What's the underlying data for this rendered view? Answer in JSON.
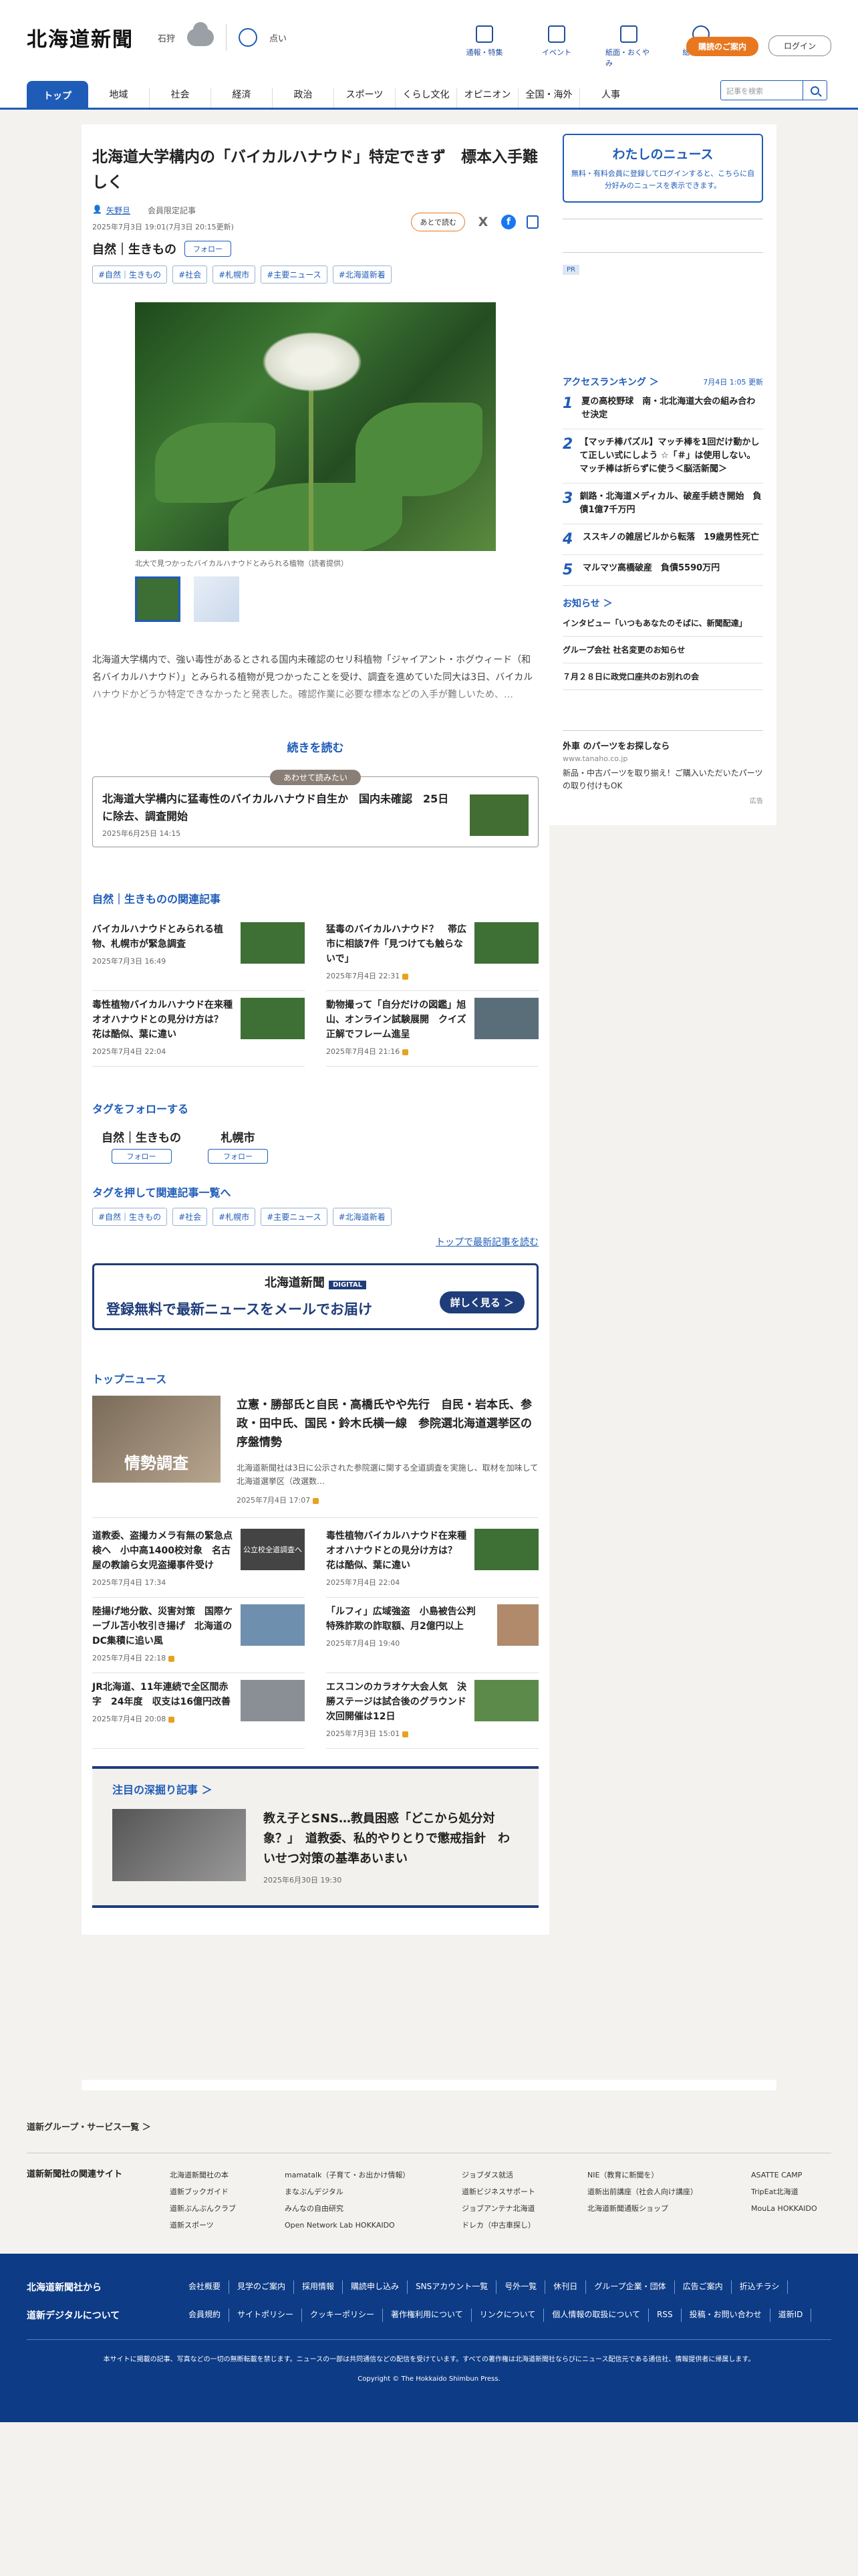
{
  "header": {
    "logo": "北海道新聞",
    "weather_location": "石狩",
    "uv_label": "点い",
    "icons": [
      {
        "label": "通報・特集",
        "icon": "flag-icon"
      },
      {
        "label": "イベント",
        "icon": "calendar-icon"
      },
      {
        "label": "紙面・おくやみ",
        "icon": "newspaper-icon"
      },
      {
        "label": "総合ガイド",
        "icon": "question-icon"
      }
    ],
    "contract_label": "購読のご案内",
    "login_label": "ログイン"
  },
  "nav": {
    "items": [
      "トップ",
      "地域",
      "社会",
      "経済",
      "政治",
      "スポーツ",
      "くらし文化",
      "オピニオン",
      "全国・海外",
      "人事"
    ],
    "search_placeholder": "記事を検索"
  },
  "article": {
    "title": "北海道大学構内の「バイカルハナウド」特定できず　標本入手難しく",
    "author": "矢野旦",
    "membership": "会員限定記事",
    "date": "2025年7月3日 19:01(7月3日 20:15更新)",
    "later_label": "あとで読む",
    "category": "自然｜生きもの",
    "follow_label": "フォロー",
    "tags": [
      "#自然｜生きもの",
      "#社会",
      "#札幌市",
      "#主要ニュース",
      "#北海道新着"
    ],
    "caption": "北大で見つかったバイカルハナウドとみられる植物（読者提供）",
    "lead": "北海道大学構内で、強い毒性があるとされる国内未確認のセリ科植物「ジャイアント・ホグウィード（和名バイカルハナウド）」とみられる植物が見つかったことを受け、調査を進めていた同大は3日、バイカルハナウドかどうか特定できなかったと発表した。確認作業に必要な標本などの入手が難しいため、…",
    "read_more": "続きを読む"
  },
  "also_read": {
    "badge": "あわせて読みたい",
    "title": "北海道大学構内に猛毒性のバイカルハナウド自生か　国内未確認　25日に除去、調査開始",
    "date": "2025年6月25日 14:15"
  },
  "related": {
    "heading": "自然｜生きものの関連記事",
    "items": [
      {
        "title": "バイカルハナウドとみられる植物、札幌市が緊急調査",
        "date": "2025年7月3日 16:49"
      },
      {
        "title": "猛毒のバイカルハナウド？　帯広市に相談7件「見つけても触らないで」",
        "date": "2025年7月4日 22:31"
      },
      {
        "title": "毒性植物バイカルハナウド在来種オオハナウドとの見分け方は？　花は酷似、葉に違い",
        "date": "2025年7月4日 22:04"
      },
      {
        "title": "動物撮って「自分だけの図鑑」旭山、オンライン試験展開　クイズ正解でフレーム進呈",
        "date": "2025年7月4日 21:16"
      }
    ]
  },
  "follow_tags": {
    "heading": "タグをフォローする",
    "items": [
      {
        "name": "自然｜生きもの",
        "label": "フォロー"
      },
      {
        "name": "札幌市",
        "label": "フォロー"
      }
    ]
  },
  "tag_search": {
    "heading": "タグを押して関連記事一覧へ",
    "tags": [
      "#自然｜生きもの",
      "#社会",
      "#札幌市",
      "#主要ニュース",
      "#北海道新着"
    ],
    "latest_link": "トップで最新記事を読む"
  },
  "banner": {
    "logo": "北海道新聞",
    "digital": "DIGITAL",
    "message": "登録無料で最新ニュースをメールでお届け",
    "cta": "詳しく見る ＞"
  },
  "top_news": {
    "heading": "トップニュース",
    "lead": {
      "title": "立憲・勝部氏と自民・高橋氏やや先行　自民・岩本氏、参政・田中氏、国民・鈴木氏横一線　参院選北海道選挙区の序盤情勢",
      "summary": "北海道新聞社は3日に公示された参院選に関する全道調査を実施し、取材を加味して北海道選挙区（改選数…",
      "date": "2025年7月4日 17:07",
      "image_text": "情勢調査"
    },
    "items": [
      {
        "title": "道教委、盗撮カメラ有無の緊急点検へ　小中高1400校対象　名古屋の教諭ら女児盗撮事件受け",
        "date": "2025年7月4日 17:34",
        "image_text": "公立校全道調査へ"
      },
      {
        "title": "毒性植物バイカルハナウド在来種オオハナウドとの見分け方は？　花は酷似、葉に違い",
        "date": "2025年7月4日 22:04"
      },
      {
        "title": "陸揚げ地分散、災害対策　国際ケーブル苫小牧引き揚げ　北海道のDC集積に追い風",
        "date": "2025年7月4日 22:18"
      },
      {
        "title": "「ルフィ」広域強盗　小島被告公判　特殊詐欺の詐取額、月2億円以上",
        "date": "2025年7月4日 19:40"
      },
      {
        "title": "JR北海道、11年連続で全区間赤字　24年度　収支は16億円改善",
        "date": "2025年7月4日 20:08"
      },
      {
        "title": "エスコンのカラオケ大会人気　決勝ステージは試合後のグラウンド　次回開催は12日",
        "date": "2025年7月3日 15:01"
      }
    ]
  },
  "deep": {
    "heading": "注目の深掘り記事 ＞",
    "title": "教え子とSNS…教員困惑「どこから処分対象？」　道教委、私的やりとりで懲戒指針　わいせつ対策の基準あいまい",
    "date": "2025年6月30日 19:30"
  },
  "sidebar": {
    "mynews_title": "わたしのニュース",
    "mynews_text": "無料・有料会員に登録してログインすると、こちらに自分好みのニュースを表示できます。",
    "pr": "PR",
    "ranking_heading": "アクセスランキング ＞",
    "ranking_updated": "7月4日 1:05 更新",
    "ranking": [
      "夏の高校野球　南・北北海道大会の組み合わせ決定",
      "【マッチ棒パズル】マッチ棒を1回だけ動かして正しい式にしよう ☆「＃」は使用しない。マッチ棒は折らずに使う＜脳活新聞＞",
      "釧路・北海道メディカル、破産手続き開始　負債1億7千万円",
      "ススキノの雑居ビルから転落　19歳男性死亡",
      "マルマツ高橋破産　負債5590万円"
    ],
    "notice_heading": "お知らせ ＞",
    "notices": [
      "インタビュー「いつもあなたのそばに、新聞配達」",
      "グループ会社 社名変更のお知らせ",
      "７月２８日に政党口座共のお別れの会"
    ],
    "ad_title": "外車 のパーツをお探しなら",
    "ad_url": "www.tanaho.co.jp",
    "ad_text": "新品・中古パーツを取り揃え！ご購入いただいたパーツの取り付けもOK",
    "ad_label": "広告"
  },
  "footer": {
    "group_heading": "道新グループ・サービス一覧 ＞",
    "sites_label": "道新新聞社の関連サイト",
    "sites": [
      [
        "北海道新聞社の本",
        "道新ブックガイド",
        "道新ぶんぶんクラブ",
        "道新スポーツ"
      ],
      [
        "mamatalk（子育て・お出かけ情報）",
        "まなぶんデジタル",
        "みんなの自由研究",
        "Open Network Lab HOKKAIDO"
      ],
      [
        "ジョブダス就活",
        "道新ビジネスサポート",
        "ジョブアンテナ北海道",
        "ドレカ（中古車探し）"
      ],
      [
        "NIE（教育に新聞を）",
        "道新出前講座（社会人向け講座）",
        "北海道新聞通販ショップ"
      ],
      [
        "ASATTE CAMP",
        "TripEat北海道",
        "MouLa HOKKAIDO"
      ]
    ],
    "from_label": "北海道新聞社から",
    "from_links": [
      "会社概要",
      "見学のご案内",
      "採用情報",
      "購読申し込み",
      "SNSアカウント一覧",
      "号外一覧",
      "休刊日",
      "グループ企業・団体",
      "広告ご案内",
      "折込チラシ"
    ],
    "digital_label": "道新デジタルについて",
    "digital_links": [
      "会員規約",
      "サイトポリシー",
      "クッキーポリシー",
      "著作権利用について",
      "リンクについて",
      "個人情報の取扱について",
      "RSS",
      "投稿・お問い合わせ",
      "道新ID"
    ],
    "note": "本サイトに掲載の記事、写真などの一切の無断転載を禁じます。ニュースの一部は共同通信などの配信を受けています。すべての著作権は北海道新聞社ならびにニュース配信元である通信社、情報提供者に帰属します。",
    "copyright": "Copyright © The Hokkaido Shimbun Press."
  }
}
